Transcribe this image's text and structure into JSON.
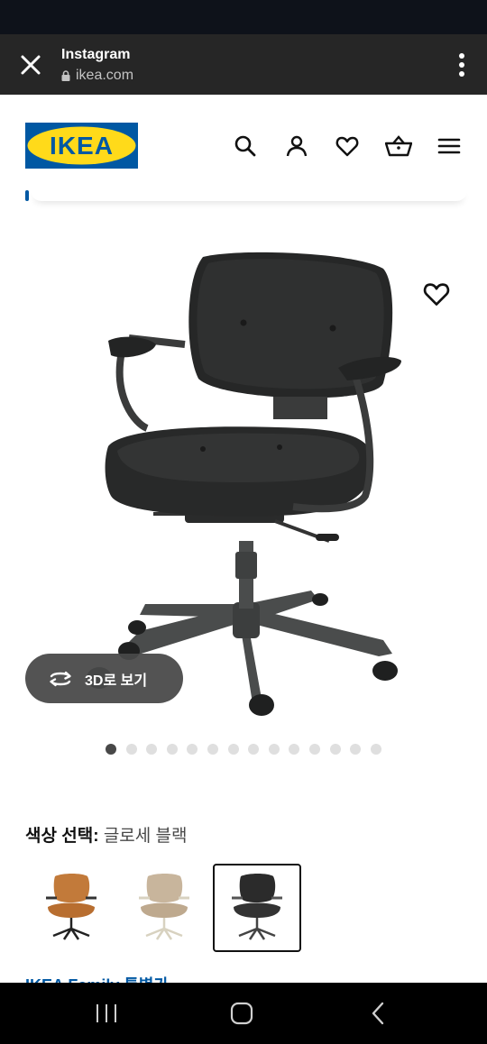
{
  "browser": {
    "title": "Instagram",
    "url": "ikea.com",
    "close_icon": "close-icon",
    "menu_icon": "more-vert-icon"
  },
  "header": {
    "logo_text": "IKEA",
    "icons": [
      "search-icon",
      "user-icon",
      "heart-icon",
      "cart-icon",
      "hamburger-menu-icon"
    ],
    "brand_blue": "#0058a3",
    "brand_yellow": "#ffda1a"
  },
  "gallery": {
    "view_3d_label": "3D로 보기",
    "image_count": 14,
    "active_index": 0
  },
  "color_select": {
    "label": "색상 선택:",
    "value": "글로세 블랙",
    "options": [
      {
        "name": "brown",
        "color": "#c27a3a"
      },
      {
        "name": "beige",
        "color": "#c8b59c"
      },
      {
        "name": "black",
        "color": "#2b2b2b"
      }
    ],
    "selected_index": 2
  },
  "family_link": "IKEA Family 특별가",
  "system_nav": [
    "recent-apps-icon",
    "home-icon",
    "back-icon"
  ]
}
